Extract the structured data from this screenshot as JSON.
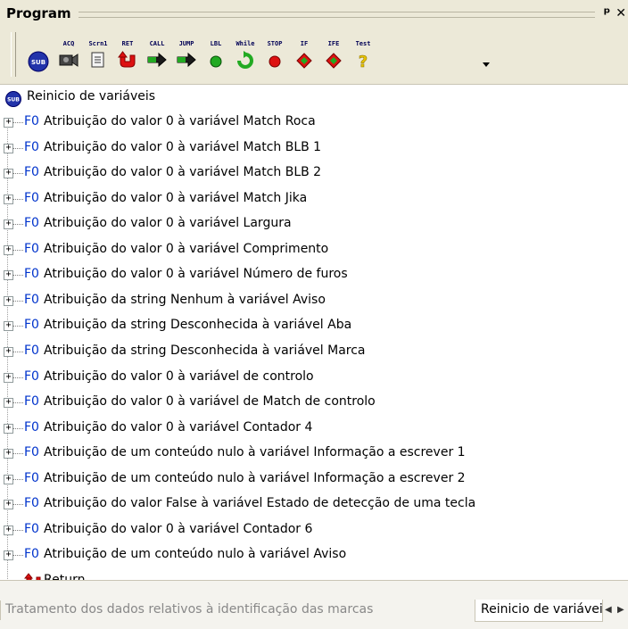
{
  "panel": {
    "title": "Program",
    "pin_icon": "pin-icon",
    "close_icon": "close-icon"
  },
  "toolbar": {
    "buttons": [
      {
        "label": "",
        "icon": "sub-icon"
      },
      {
        "label": "ACQ",
        "icon": "camera-icon"
      },
      {
        "label": "Scrn1",
        "icon": "screen-icon"
      },
      {
        "label": "RET",
        "icon": "return-icon"
      },
      {
        "label": "CALL",
        "icon": "call-arrow-icon"
      },
      {
        "label": "JUMP",
        "icon": "jump-arrow-icon"
      },
      {
        "label": "LBL",
        "icon": "label-dot-icon"
      },
      {
        "label": "While",
        "icon": "while-loop-icon"
      },
      {
        "label": "STOP",
        "icon": "stop-icon"
      },
      {
        "label": "IF",
        "icon": "if-diamond-icon"
      },
      {
        "label": "IFE",
        "icon": "ife-diamond-icon"
      },
      {
        "label": "Test",
        "icon": "test-question-icon"
      }
    ],
    "dropdown_icon": "chevron-down-icon"
  },
  "tree": {
    "root": {
      "icon": "sub-icon",
      "label": "Reinicio de variáveis"
    },
    "prefix": "F0",
    "items": [
      "Atribuição do valor 0 à variável Match Roca",
      "Atribuição do valor 0 à variável Match BLB 1",
      "Atribuição do valor 0 à variável Match BLB 2",
      "Atribuição do valor 0 à variável Match Jika",
      "Atribuição do valor 0 à variável Largura",
      "Atribuição do valor 0 à variável Comprimento",
      "Atribuição do valor 0 à variável Número de furos",
      "Atribuição da string Nenhum à variável Aviso",
      "Atribuição da string Desconhecida à variável Aba",
      "Atribuição da string Desconhecida à variável Marca",
      "Atribuição do valor 0 à variável de controlo",
      "Atribuição do valor 0 à variável de Match de controlo",
      "Atribuição do valor 0 à variável Contador 4",
      "Atribuição de um conteúdo nulo à variável Informação a escrever 1",
      "Atribuição de um conteúdo nulo à variável Informação a escrever 2",
      "Atribuição do valor False à variável Estado de detecção de uma tecla",
      "Atribuição do valor 0 à variável Contador 6",
      "Atribuição de um conteúdo nulo à variável Aviso"
    ],
    "return_label": "Return"
  },
  "tabs": {
    "items": [
      "Tratamento dos dados relativos à identificação das marcas",
      "Reinicio de variáveis"
    ],
    "active": "Reinicio de variáveis",
    "prev_icon": "scroll-left-icon",
    "next_icon": "scroll-right-icon"
  }
}
